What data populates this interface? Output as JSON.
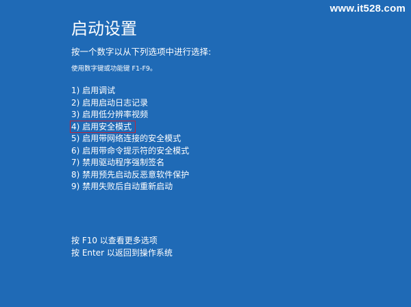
{
  "watermark": "www.it528.com",
  "title": "启动设置",
  "subtitle": "按一个数字以从下列选项中进行选择:",
  "hint": "使用数字键或功能键 F1-F9。",
  "options": [
    {
      "label": "1) 启用调试"
    },
    {
      "label": "2) 启用启动日志记录"
    },
    {
      "label": "3) 启用低分辨率视频"
    },
    {
      "label": "4) 启用安全模式"
    },
    {
      "label": "5) 启用带网络连接的安全模式"
    },
    {
      "label": "6) 启用带命令提示符的安全模式"
    },
    {
      "label": "7) 禁用驱动程序强制签名"
    },
    {
      "label": "8) 禁用预先启动反恶意软件保护"
    },
    {
      "label": "9) 禁用失败后自动重新启动"
    }
  ],
  "highlighted_option": "4) 启用安全模式",
  "footer": {
    "more_options": "按 F10 以查看更多选项",
    "return_os": "按 Enter 以返回到操作系统"
  },
  "colors": {
    "background": "#1f6ab6",
    "text": "#ffffff",
    "highlight_border": "#c0243a"
  }
}
